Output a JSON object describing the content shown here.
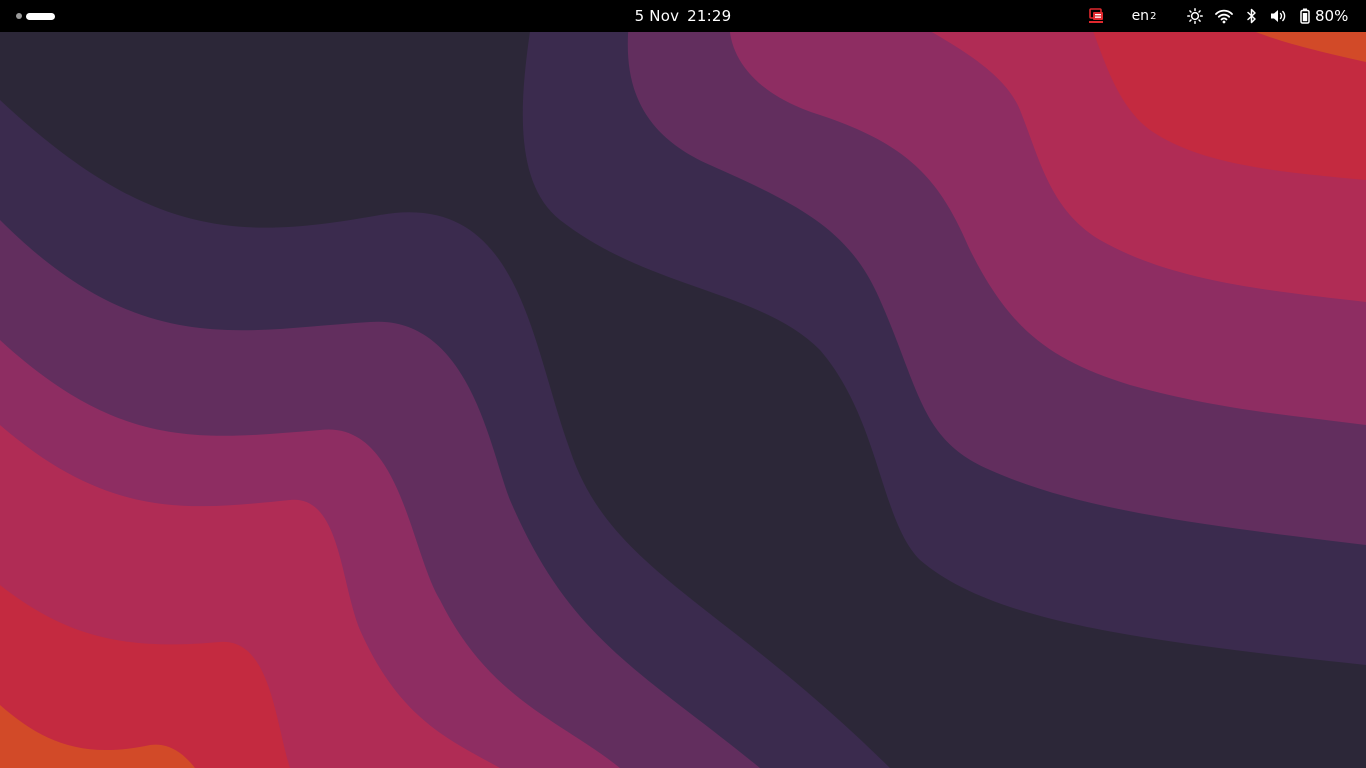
{
  "topbar": {
    "clock": {
      "date": "5 Nov",
      "time": "21:29"
    },
    "input_source": {
      "language": "en",
      "index": "2"
    },
    "battery": {
      "percent": "80%"
    },
    "icons": [
      "activities-indicator",
      "remote-desktop-icon",
      "night-light-icon",
      "wifi-icon",
      "bluetooth-icon",
      "volume-icon",
      "battery-icon"
    ]
  },
  "colors": {
    "topbar": "#000000",
    "accent_red": "#c2253c",
    "remote_icon": "#e0282e",
    "wallpaper_bands": [
      "#2c2738",
      "#3b2b4e",
      "#622e5e",
      "#8e2d62",
      "#b02c55",
      "#c42a40",
      "#d24a28"
    ]
  }
}
